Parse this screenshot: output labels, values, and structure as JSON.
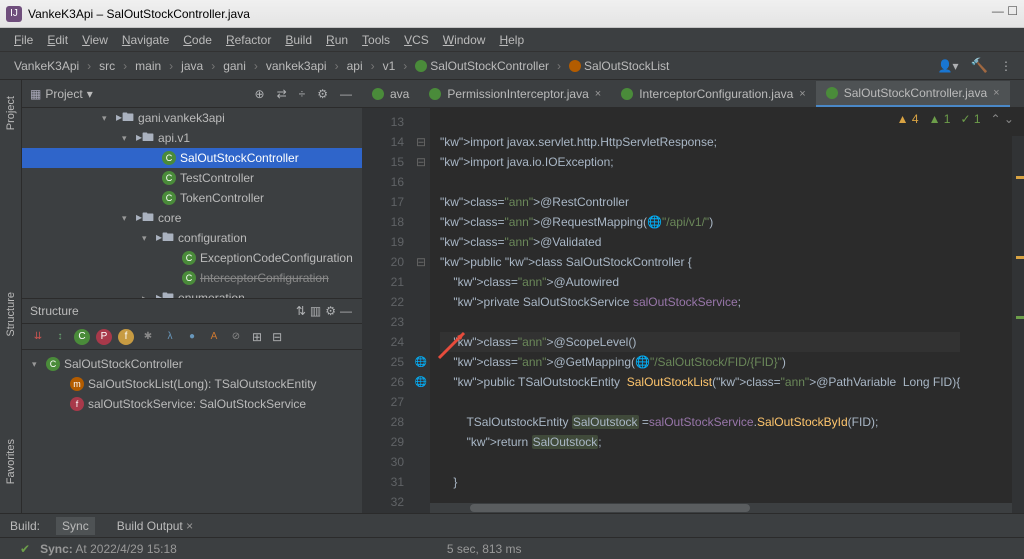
{
  "title": {
    "project": "VankeK3Api",
    "file": "SalOutStockController.java"
  },
  "menu": [
    "File",
    "Edit",
    "View",
    "Navigate",
    "Code",
    "Refactor",
    "Build",
    "Run",
    "Tools",
    "VCS",
    "Window",
    "Help"
  ],
  "breadcrumbs": [
    "VankeK3Api",
    "src",
    "main",
    "java",
    "gani",
    "vankek3api",
    "api",
    "v1",
    "SalOutStockController",
    "SalOutStockList"
  ],
  "projectPanel": {
    "title": "Project"
  },
  "tree": [
    {
      "indent": 80,
      "arrow": "▾",
      "type": "pkg",
      "label": "gani.vankek3api"
    },
    {
      "indent": 100,
      "arrow": "▾",
      "type": "pkg",
      "label": "api.v1"
    },
    {
      "indent": 126,
      "arrow": "",
      "type": "cls",
      "label": "SalOutStockController",
      "sel": true
    },
    {
      "indent": 126,
      "arrow": "",
      "type": "cls",
      "label": "TestController"
    },
    {
      "indent": 126,
      "arrow": "",
      "type": "cls",
      "label": "TokenController"
    },
    {
      "indent": 100,
      "arrow": "▾",
      "type": "pkg",
      "label": "core"
    },
    {
      "indent": 120,
      "arrow": "▾",
      "type": "pkg",
      "label": "configuration"
    },
    {
      "indent": 146,
      "arrow": "",
      "type": "cls",
      "label": "ExceptionCodeConfiguration"
    },
    {
      "indent": 146,
      "arrow": "",
      "type": "cls",
      "label": "InterceptorConfiguration",
      "strike": true
    },
    {
      "indent": 120,
      "arrow": "▸",
      "type": "pkg",
      "label": "enumeration"
    }
  ],
  "structurePanel": {
    "title": "Structure"
  },
  "structure": [
    {
      "indent": 10,
      "arrow": "▾",
      "icon": "C",
      "bg": "#4a8b3a",
      "label": "SalOutStockController"
    },
    {
      "indent": 34,
      "arrow": "",
      "icon": "m",
      "bg": "#b35c00",
      "label": "SalOutStockList(Long): TSalOutstockEntity"
    },
    {
      "indent": 34,
      "arrow": "",
      "icon": "f",
      "bg": "#a8394a",
      "label": "salOutStockService: SalOutStockService"
    }
  ],
  "editorTabs": [
    {
      "label": "ava",
      "active": false,
      "close": false
    },
    {
      "label": "PermissionInterceptor.java",
      "active": false,
      "close": true
    },
    {
      "label": "InterceptorConfiguration.java",
      "active": false,
      "close": true
    },
    {
      "label": "SalOutStockController.java",
      "active": true,
      "close": true
    }
  ],
  "inspections": {
    "a": "4",
    "g": "1",
    "c": "1"
  },
  "lineStart": 13,
  "gutterIcons": {
    "20": "🌐",
    "24": "",
    "25": "🌐",
    "26": "🌐"
  },
  "code": [
    "",
    "import javax.servlet.http.HttpServletResponse;",
    "import java.io.IOException;",
    "",
    "@RestController",
    "@RequestMapping(🌐\"/api/v1/\")",
    "@Validated",
    "public class SalOutStockController {",
    "    @Autowired",
    "    private SalOutStockService salOutStockService;",
    "",
    "    @ScopeLevel()",
    "    @GetMapping(🌐\"/SalOutStock/FID/{FID}\")",
    "    public TSalOutstockEntity  SalOutStockList(@PathVariable  Long FID){",
    "",
    "        TSalOutstockEntity SalOutstock =salOutStockService.SalOutStockById(FID);",
    "        return SalOutstock;",
    "",
    "    }",
    ""
  ],
  "buildTabs": {
    "label": "Build:",
    "tabs": [
      "Sync",
      "Build Output"
    ]
  },
  "status": {
    "sync": "Sync:",
    "at": "At 2022/4/29 15:18",
    "time": "5 sec, 813 ms"
  }
}
